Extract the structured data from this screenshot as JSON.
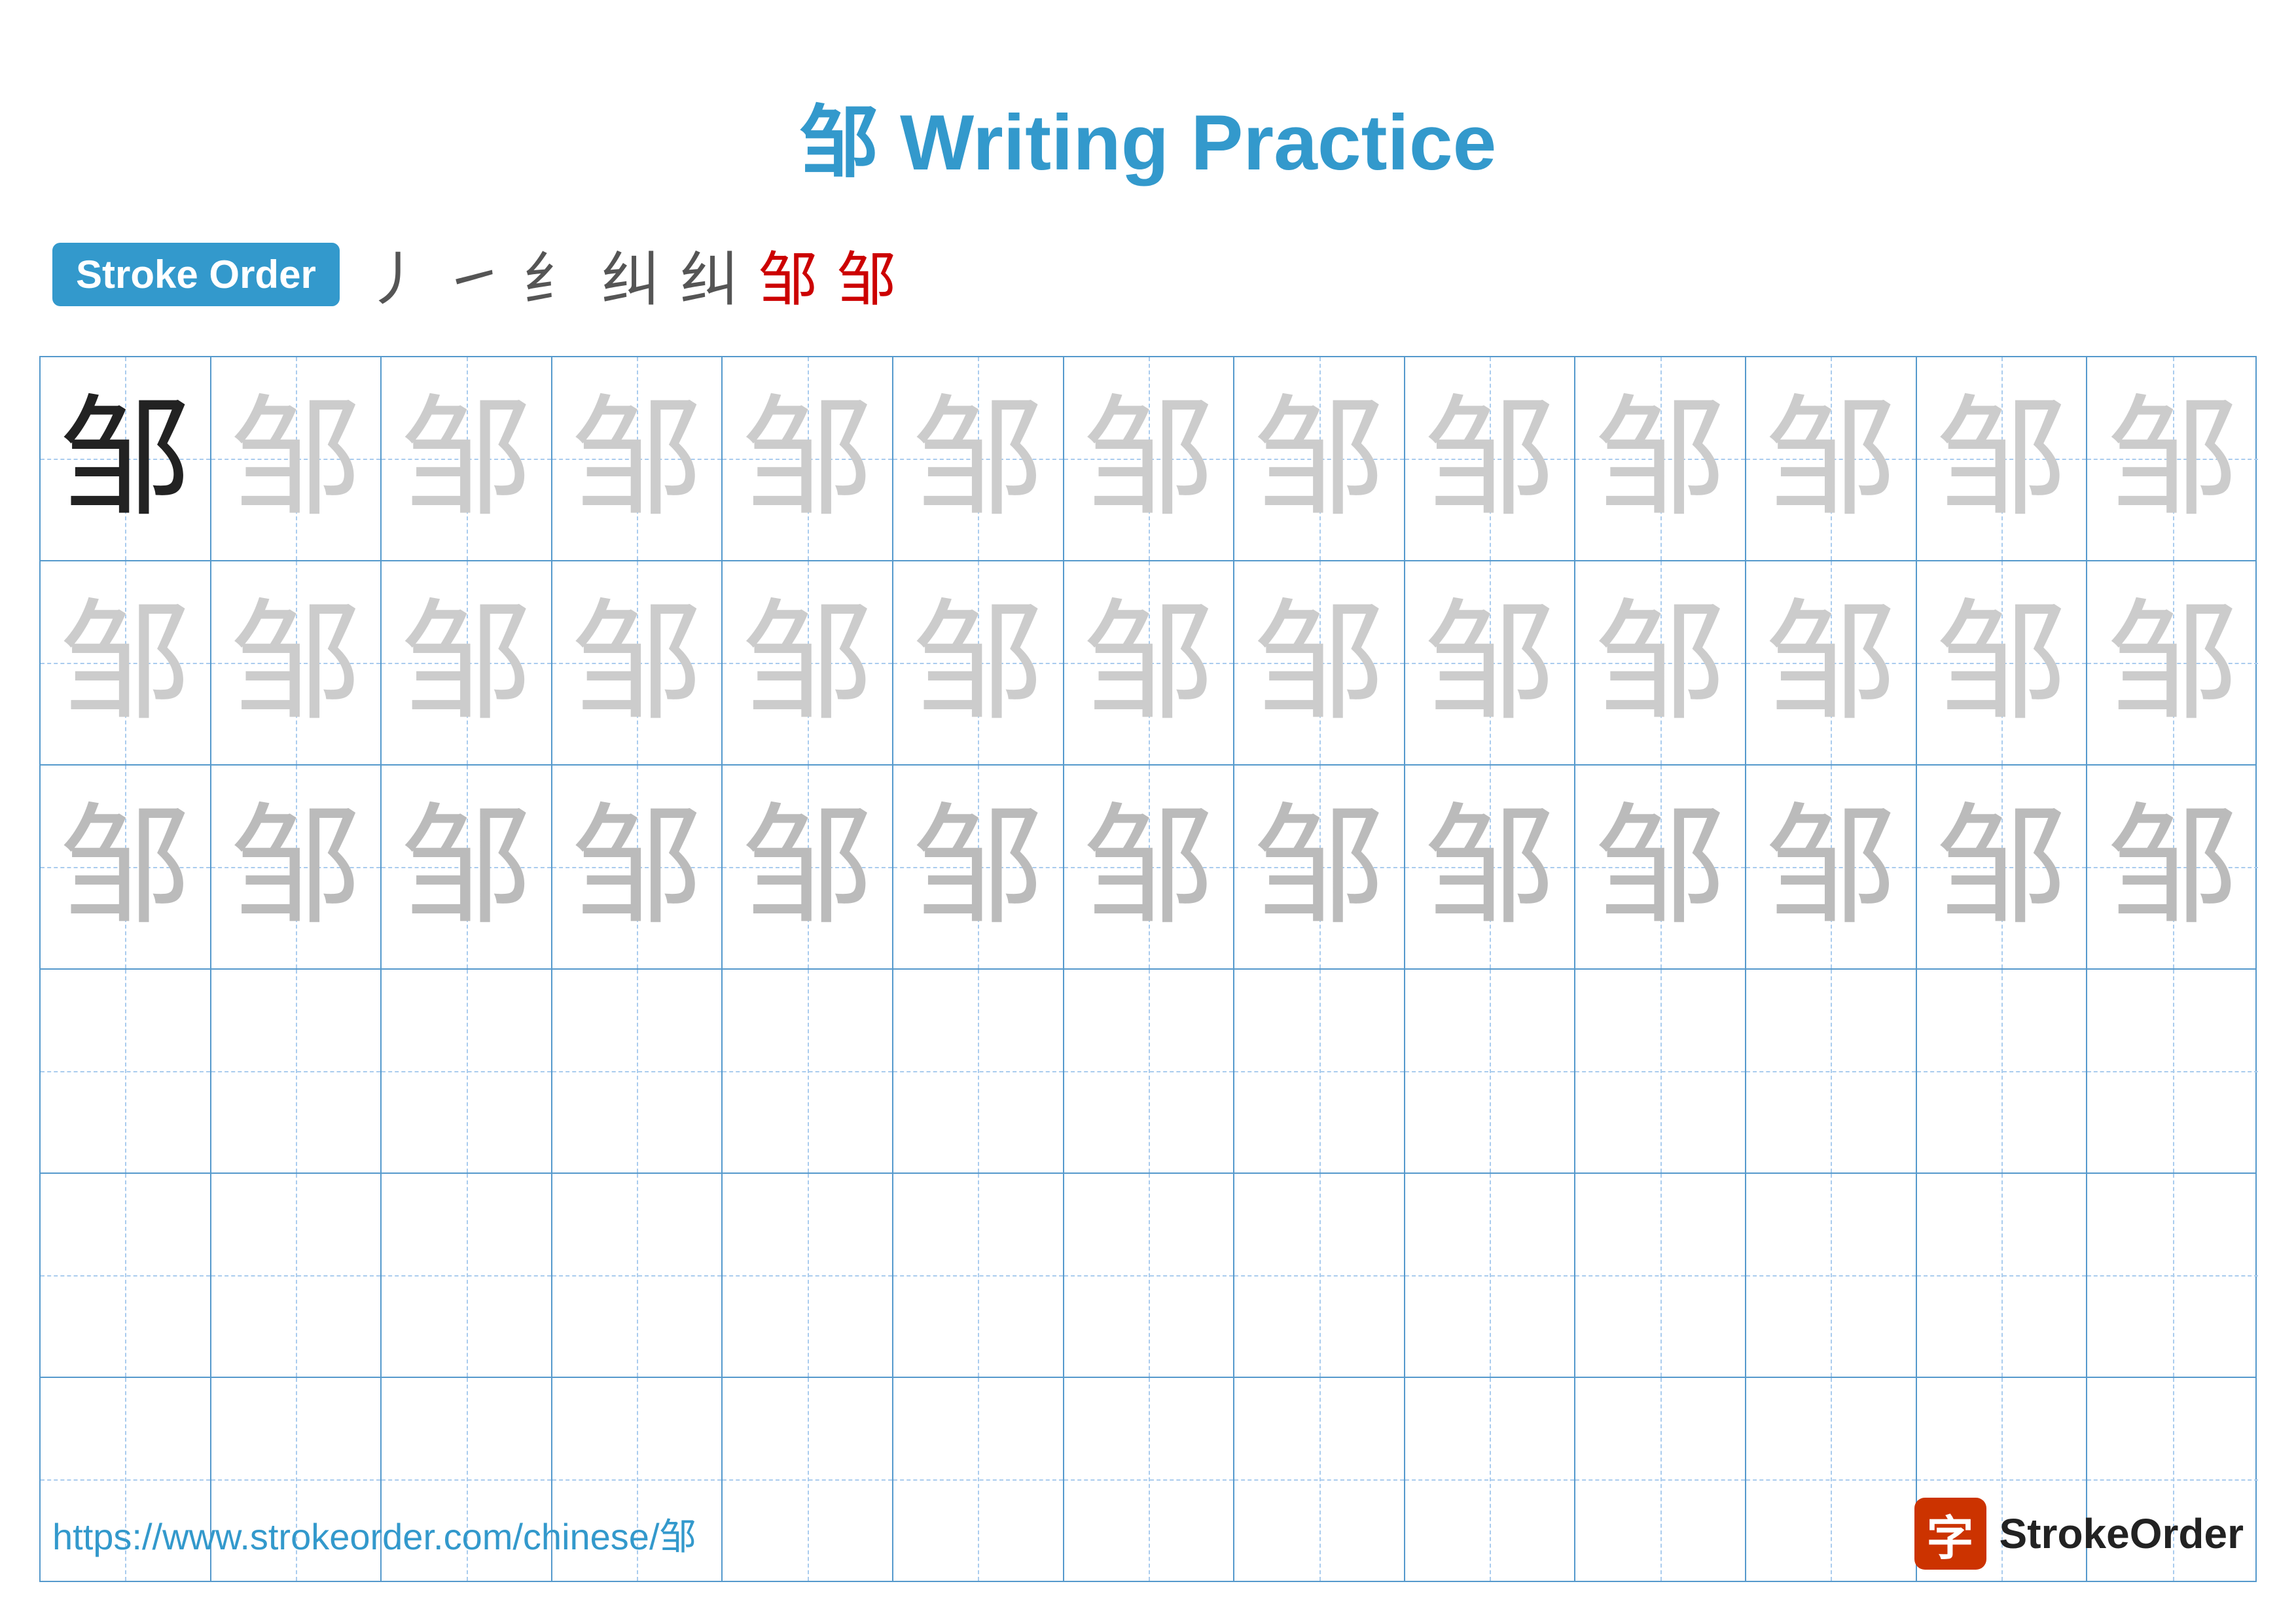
{
  "title": "邹 Writing Practice",
  "stroke_order": {
    "badge_label": "Stroke Order",
    "strokes": [
      "丿",
      "㇀",
      "纟",
      "纠",
      "纠",
      "邹",
      "邹"
    ]
  },
  "grid": {
    "rows": 6,
    "cols": 13,
    "character": "邹",
    "row_types": [
      "dark-then-light",
      "light",
      "lighter",
      "empty",
      "empty",
      "empty"
    ]
  },
  "footer": {
    "url": "https://www.strokeorder.com/chinese/邹",
    "logo_text": "StrokeOrder",
    "logo_icon": "字"
  }
}
